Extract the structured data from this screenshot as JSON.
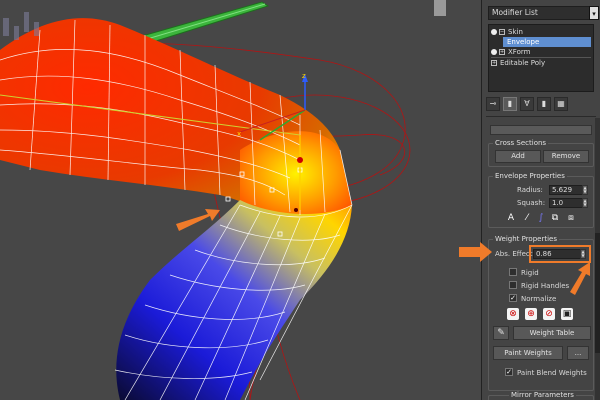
{
  "panel": {
    "modifier_list_label": "Modifier List",
    "stack": [
      {
        "label": "Skin",
        "selected": false
      },
      {
        "label": "Envelope",
        "selected": true
      },
      {
        "label": "XForm",
        "selected": false
      },
      {
        "label": "Editable Poly",
        "selected": false
      }
    ],
    "cross_sections": {
      "title": "Cross Sections",
      "add_label": "Add",
      "remove_label": "Remove"
    },
    "envelope_properties": {
      "title": "Envelope Properties",
      "radius_label": "Radius:",
      "radius_value": "5.629",
      "squash_label": "Squash:",
      "squash_value": "1.0"
    },
    "weight_properties": {
      "title": "Weight Properties",
      "abs_effect_label": "Abs. Effect:",
      "abs_effect_value": "0.86",
      "rigid_label": "Rigid",
      "rigid_handles_label": "Rigid Handles",
      "normalize_label": "Normalize",
      "normalize_checked": true,
      "weight_table_label": "Weight Table",
      "paint_weights_label": "Paint Weights",
      "paint_options_label": "...",
      "paint_blend_label": "Paint Blend Weights",
      "paint_blend_checked": true
    },
    "mirror_parameters_title": "Mirror Parameters"
  },
  "colors": {
    "accent_orange": "#f07b2a",
    "selection_blue": "#5f8fd1",
    "envelope_red": "#c81e1e",
    "bone_green": "#2fa82f"
  }
}
